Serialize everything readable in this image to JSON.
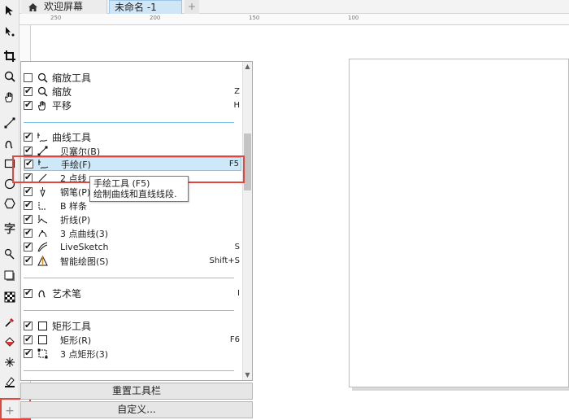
{
  "tabs": {
    "welcome": "欢迎屏幕",
    "active": "未命名 -1",
    "add": "+"
  },
  "ruler": {
    "t1": "250",
    "t2": "200",
    "t3": "150",
    "t4": "100"
  },
  "groups": {
    "zoom": {
      "header": "缩放工具",
      "items": [
        {
          "label": "缩放",
          "key": "Z"
        },
        {
          "label": "平移",
          "key": "H"
        }
      ]
    },
    "curve": {
      "header": "曲线工具",
      "items": [
        {
          "label": "贝塞尔(B)",
          "key": ""
        },
        {
          "label": "手绘(F)",
          "key": "F5"
        },
        {
          "label": "2 点线",
          "key": ""
        },
        {
          "label": "钢笔(P)",
          "key": ""
        },
        {
          "label": "B 样条",
          "key": ""
        },
        {
          "label": "折线(P)",
          "key": ""
        },
        {
          "label": "3 点曲线(3)",
          "key": ""
        },
        {
          "label": "LiveSketch",
          "key": "S"
        },
        {
          "label": "智能绘图(S)",
          "key": "Shift+S"
        }
      ]
    },
    "art": {
      "header": "艺术笔",
      "key": "I"
    },
    "rect": {
      "header": "矩形工具",
      "items": [
        {
          "label": "矩形(R)",
          "key": "F6"
        },
        {
          "label": "3 点矩形(3)",
          "key": ""
        }
      ]
    }
  },
  "tooltip": {
    "title": "手绘工具 (F5)",
    "desc": "绘制曲线和直线线段."
  },
  "buttons": {
    "reset": "重置工具栏",
    "customize": "自定义..."
  },
  "toolbox_add": "+",
  "colors": {
    "highlight": "#cde8f8",
    "separator": "#7cc6e8",
    "annotation": "#e4453d"
  }
}
